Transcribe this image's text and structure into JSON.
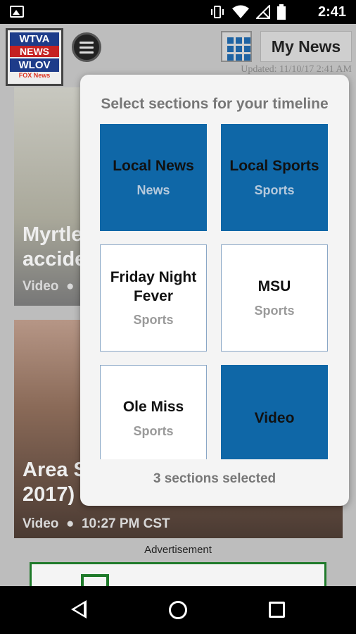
{
  "status_bar": {
    "time": "2:41",
    "icons": [
      "image-icon",
      "vibrate-icon",
      "wifi-icon",
      "no-signal-icon",
      "battery-icon"
    ]
  },
  "header": {
    "logo": {
      "line1": "WTVA",
      "line2": "NEWS",
      "line3": "WLOV",
      "line4": "FOX News"
    },
    "my_news_label": "My News",
    "updated_text": "Updated: 11/10/17 2:41 AM"
  },
  "feed": {
    "cards": [
      {
        "title": "Myrtle\naccide",
        "meta": "Video  ●"
      },
      {
        "title": "Area S\n2017)",
        "meta": "Video  ●  10:27 PM CST"
      }
    ],
    "ad_label": "Advertisement"
  },
  "dialog": {
    "title": "Select sections for your timeline",
    "tiles": [
      {
        "name": "Local News",
        "category": "News",
        "selected": true
      },
      {
        "name": "Local Sports",
        "category": "Sports",
        "selected": true
      },
      {
        "name": "Friday Night Fever",
        "category": "Sports",
        "selected": false
      },
      {
        "name": "MSU",
        "category": "Sports",
        "selected": false
      },
      {
        "name": "Ole Miss",
        "category": "Sports",
        "selected": false
      },
      {
        "name": "Video",
        "category": "",
        "selected": true
      }
    ],
    "footer": "3 sections selected"
  },
  "colors": {
    "tile_selected": "#0f67a7",
    "tile_border": "#8aa7c6",
    "accent_grid": "#1e63a3"
  }
}
